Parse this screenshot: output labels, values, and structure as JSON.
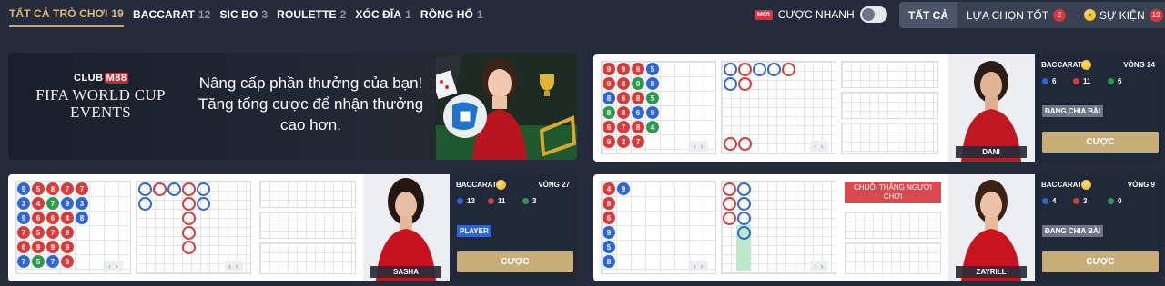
{
  "nav": {
    "tabs": [
      {
        "label": "TẤT CẢ TRÒ CHƠI",
        "count": "19"
      },
      {
        "label": "BACCARAT",
        "count": "12"
      },
      {
        "label": "SIC BO",
        "count": "3"
      },
      {
        "label": "ROULETTE",
        "count": "2"
      },
      {
        "label": "XÓC ĐĨA",
        "count": "1"
      },
      {
        "label": "RỒNG HỔ",
        "count": "1"
      }
    ],
    "quick_badge": "MỚI",
    "quick_label": "CƯỢC NHANH",
    "filters": [
      {
        "label": "TẤT CẢ"
      },
      {
        "label": "LỰA CHỌN TỐT",
        "count": "2"
      },
      {
        "label": "SỰ KIỆN",
        "count": "19"
      }
    ]
  },
  "banner": {
    "club_prefix": "CLUB",
    "club_brand": "M88",
    "title": "FIFA WORLD CUP EVENTS",
    "promo": "Nâng cấp phần thưởng của bạn! Tăng tổng cược để nhận thưởng cao hơn."
  },
  "tables": [
    {
      "name": "BACCARAT 1",
      "round": "VÒNG 24",
      "stats": [
        "6",
        "11",
        "6"
      ],
      "status": "ĐANG CHIA BÀI",
      "bet": "CƯỢC",
      "dealer": "DANI"
    },
    {
      "name": "BACCARAT 2",
      "round": "VÒNG 27",
      "stats": [
        "13",
        "11",
        "3"
      ],
      "status": "PLAYER",
      "bet": "CƯỢC",
      "dealer": "SASHA"
    },
    {
      "name": "BACCARAT 3",
      "round": "VÒNG 9",
      "stats": [
        "4",
        "3",
        "0"
      ],
      "status": "ĐANG CHIA BÀI",
      "bet": "CƯỢC",
      "dealer": "ZAYRILL",
      "streak": "CHUỖI THẮNG NGƯỜI CHƠI"
    }
  ],
  "road_nav": "‹ ›",
  "colors": {
    "accent": "#c7ad78",
    "banker": "#d93a3a",
    "player": "#2e65d9",
    "tie": "#2e9a4d",
    "badge": "#d2363f"
  }
}
